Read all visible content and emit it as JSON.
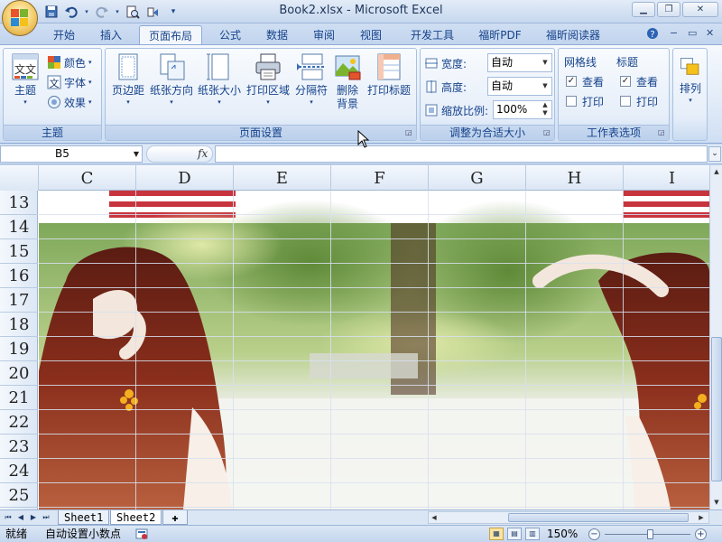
{
  "window": {
    "title": "Book2.xlsx - Microsoft Excel",
    "controls": [
      "minimize-icon",
      "restore-icon",
      "close-icon"
    ]
  },
  "quick_access": [
    "save-icon",
    "undo-icon",
    "redo-icon",
    "print-preview-icon",
    "customize-icon"
  ],
  "tabs": [
    {
      "label": "开始"
    },
    {
      "label": "插入"
    },
    {
      "label": "页面布局",
      "active": true
    },
    {
      "label": "公式"
    },
    {
      "label": "数据"
    },
    {
      "label": "审阅"
    },
    {
      "label": "视图"
    },
    {
      "label": "开发工具"
    },
    {
      "label": "福昕PDF"
    },
    {
      "label": "福昕阅读器"
    }
  ],
  "ribbon": {
    "theme_group": {
      "label": "主题",
      "themes_button": "主题",
      "colors_button": "颜色",
      "fonts_button": "字体",
      "effects_button": "效果",
      "theme_icon_text": "文文"
    },
    "page_setup_group": {
      "label": "页面设置",
      "buttons": [
        "页边距",
        "纸张方向",
        "纸张大小",
        "打印区域",
        "分隔符",
        "删除\n背景",
        "打印标题"
      ],
      "delete_bg_line1": "删除",
      "delete_bg_line2": "背景"
    },
    "scale_group": {
      "label": "调整为合适大小",
      "width_label": "宽度:",
      "width_value": "自动",
      "height_label": "高度:",
      "height_value": "自动",
      "scale_label": "缩放比例:",
      "scale_value": "100%"
    },
    "sheet_options_group": {
      "label": "工作表选项",
      "gridlines_header": "网格线",
      "headings_header": "标题",
      "gridlines_view": {
        "label": "查看",
        "checked": true
      },
      "gridlines_print": {
        "label": "打印",
        "checked": false
      },
      "headings_view": {
        "label": "查看",
        "checked": true
      },
      "headings_print": {
        "label": "打印",
        "checked": false
      }
    },
    "arrange_group": {
      "button": "排列"
    }
  },
  "formula_bar": {
    "name_box": "B5",
    "fx_label": "fx",
    "formula": ""
  },
  "grid": {
    "columns": [
      "C",
      "D",
      "E",
      "F",
      "G",
      "H",
      "I"
    ],
    "rows": [
      "13",
      "14",
      "15",
      "16",
      "17",
      "18",
      "19",
      "20",
      "21",
      "22",
      "23",
      "24",
      "25"
    ]
  },
  "sheets": [
    {
      "name": "Sheet1",
      "active": false
    },
    {
      "name": "Sheet2",
      "active": true
    }
  ],
  "status": {
    "ready": "就绪",
    "auto_decimal": "自动设置小数点",
    "zoom": "150%"
  },
  "colors": {
    "accent": "#15428b",
    "ribbon_bg": "#dfe9f5",
    "office_orb": "#f0b53c"
  }
}
